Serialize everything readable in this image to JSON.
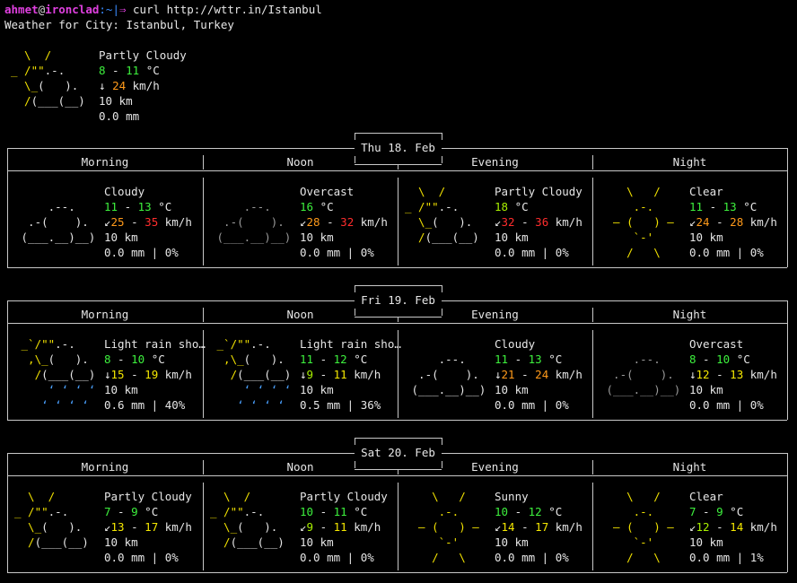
{
  "prompt": {
    "user": "ahmet",
    "at": "@",
    "host": "ironclad",
    "path": ":~|",
    "arrow": "⇒",
    "command": "curl http://wttr.in/Istanbul"
  },
  "location_line": "Weather for City: Istanbul, Turkey",
  "current": {
    "icon": "partly-cloudy",
    "condition": "Partly Cloudy",
    "temp": [
      "8",
      "11"
    ],
    "temp_colors": [
      "#3df03d",
      "#3df03d"
    ],
    "temp_unit": "°C",
    "wind_arrow": "↓",
    "wind": [
      "24"
    ],
    "wind_colors": [
      "#ff9a1a"
    ],
    "wind_unit": "km/h",
    "visibility": "10 km",
    "precip": "0.0 mm"
  },
  "colors": {
    "sun": "#f0e000",
    "cloud_dim": "#9a9a9a",
    "rain": "#4aa0ff",
    "border": "#c8c8c8"
  },
  "days": [
    {
      "date": "Thu 18. Feb",
      "periods": [
        {
          "name": "Morning",
          "icon": "cloudy",
          "condition": "Cloudy",
          "temp": [
            "11",
            "13"
          ],
          "temp_colors": [
            "#3df03d",
            "#3df03d"
          ],
          "wind_arrow": "↙",
          "wind": [
            "25",
            "35"
          ],
          "wind_colors": [
            "#ff9a1a",
            "#ff2d2d"
          ],
          "visibility": "10 km",
          "precip": "0.0 mm | 0%"
        },
        {
          "name": "Noon",
          "icon": "overcast",
          "condition": "Overcast",
          "temp": [
            "16"
          ],
          "temp_colors": [
            "#3df03d"
          ],
          "wind_arrow": "↙",
          "wind": [
            "28",
            "32"
          ],
          "wind_colors": [
            "#ff9a1a",
            "#ff2d2d"
          ],
          "visibility": "10 km",
          "precip": "0.0 mm | 0%"
        },
        {
          "name": "Evening",
          "icon": "partly-cloudy",
          "condition": "Partly Cloudy",
          "temp": [
            "18"
          ],
          "temp_colors": [
            "#a8f000"
          ],
          "wind_arrow": "↙",
          "wind": [
            "32",
            "36"
          ],
          "wind_colors": [
            "#ff2d2d",
            "#ff2d2d"
          ],
          "visibility": "10 km",
          "precip": "0.0 mm | 0%"
        },
        {
          "name": "Night",
          "icon": "clear",
          "condition": "Clear",
          "temp": [
            "11",
            "13"
          ],
          "temp_colors": [
            "#3df03d",
            "#3df03d"
          ],
          "wind_arrow": "↙",
          "wind": [
            "24",
            "28"
          ],
          "wind_colors": [
            "#ff9a1a",
            "#ff9a1a"
          ],
          "visibility": "10 km",
          "precip": "0.0 mm | 0%"
        }
      ]
    },
    {
      "date": "Fri 19. Feb",
      "periods": [
        {
          "name": "Morning",
          "icon": "light-rain",
          "condition": "Light rain sho…",
          "temp": [
            "8",
            "10"
          ],
          "temp_colors": [
            "#3df03d",
            "#3df03d"
          ],
          "wind_arrow": "↓",
          "wind": [
            "15",
            "19"
          ],
          "wind_colors": [
            "#f5e800",
            "#f5e800"
          ],
          "visibility": "10 km",
          "precip": "0.6 mm | 40%"
        },
        {
          "name": "Noon",
          "icon": "light-rain",
          "condition": "Light rain sho…",
          "temp": [
            "11",
            "12"
          ],
          "temp_colors": [
            "#3df03d",
            "#3df03d"
          ],
          "wind_arrow": "↓",
          "wind": [
            "9",
            "11"
          ],
          "wind_colors": [
            "#a8f000",
            "#f5e800"
          ],
          "visibility": "10 km",
          "precip": "0.5 mm | 36%"
        },
        {
          "name": "Evening",
          "icon": "cloudy",
          "condition": "Cloudy",
          "temp": [
            "11",
            "13"
          ],
          "temp_colors": [
            "#3df03d",
            "#3df03d"
          ],
          "wind_arrow": "↓",
          "wind": [
            "21",
            "24"
          ],
          "wind_colors": [
            "#ff9a1a",
            "#ff9a1a"
          ],
          "visibility": "10 km",
          "precip": "0.0 mm | 0%"
        },
        {
          "name": "Night",
          "icon": "overcast",
          "condition": "Overcast",
          "temp": [
            "8",
            "10"
          ],
          "temp_colors": [
            "#3df03d",
            "#3df03d"
          ],
          "wind_arrow": "↓",
          "wind": [
            "12",
            "13"
          ],
          "wind_colors": [
            "#f5e800",
            "#f5e800"
          ],
          "visibility": "10 km",
          "precip": "0.0 mm | 0%"
        }
      ]
    },
    {
      "date": "Sat 20. Feb",
      "periods": [
        {
          "name": "Morning",
          "icon": "partly-cloudy",
          "condition": "Partly Cloudy",
          "temp": [
            "7",
            "9"
          ],
          "temp_colors": [
            "#3df03d",
            "#3df03d"
          ],
          "wind_arrow": "↙",
          "wind": [
            "13",
            "17"
          ],
          "wind_colors": [
            "#f5e800",
            "#f5e800"
          ],
          "visibility": "10 km",
          "precip": "0.0 mm | 0%"
        },
        {
          "name": "Noon",
          "icon": "partly-cloudy",
          "condition": "Partly Cloudy",
          "temp": [
            "10",
            "11"
          ],
          "temp_colors": [
            "#3df03d",
            "#3df03d"
          ],
          "wind_arrow": "↙",
          "wind": [
            "9",
            "11"
          ],
          "wind_colors": [
            "#a8f000",
            "#f5e800"
          ],
          "visibility": "10 km",
          "precip": "0.0 mm | 0%"
        },
        {
          "name": "Evening",
          "icon": "sunny",
          "condition": "Sunny",
          "temp": [
            "10",
            "12"
          ],
          "temp_colors": [
            "#3df03d",
            "#3df03d"
          ],
          "wind_arrow": "↙",
          "wind": [
            "14",
            "17"
          ],
          "wind_colors": [
            "#f5e800",
            "#f5e800"
          ],
          "visibility": "10 km",
          "precip": "0.0 mm | 0%"
        },
        {
          "name": "Night",
          "icon": "clear",
          "condition": "Clear",
          "temp": [
            "7",
            "9"
          ],
          "temp_colors": [
            "#3df03d",
            "#3df03d"
          ],
          "wind_arrow": "↙",
          "wind": [
            "12",
            "14"
          ],
          "wind_colors": [
            "#a8f000",
            "#f5e800"
          ],
          "visibility": "10 km",
          "precip": "0.0 mm | 1%"
        }
      ]
    }
  ]
}
